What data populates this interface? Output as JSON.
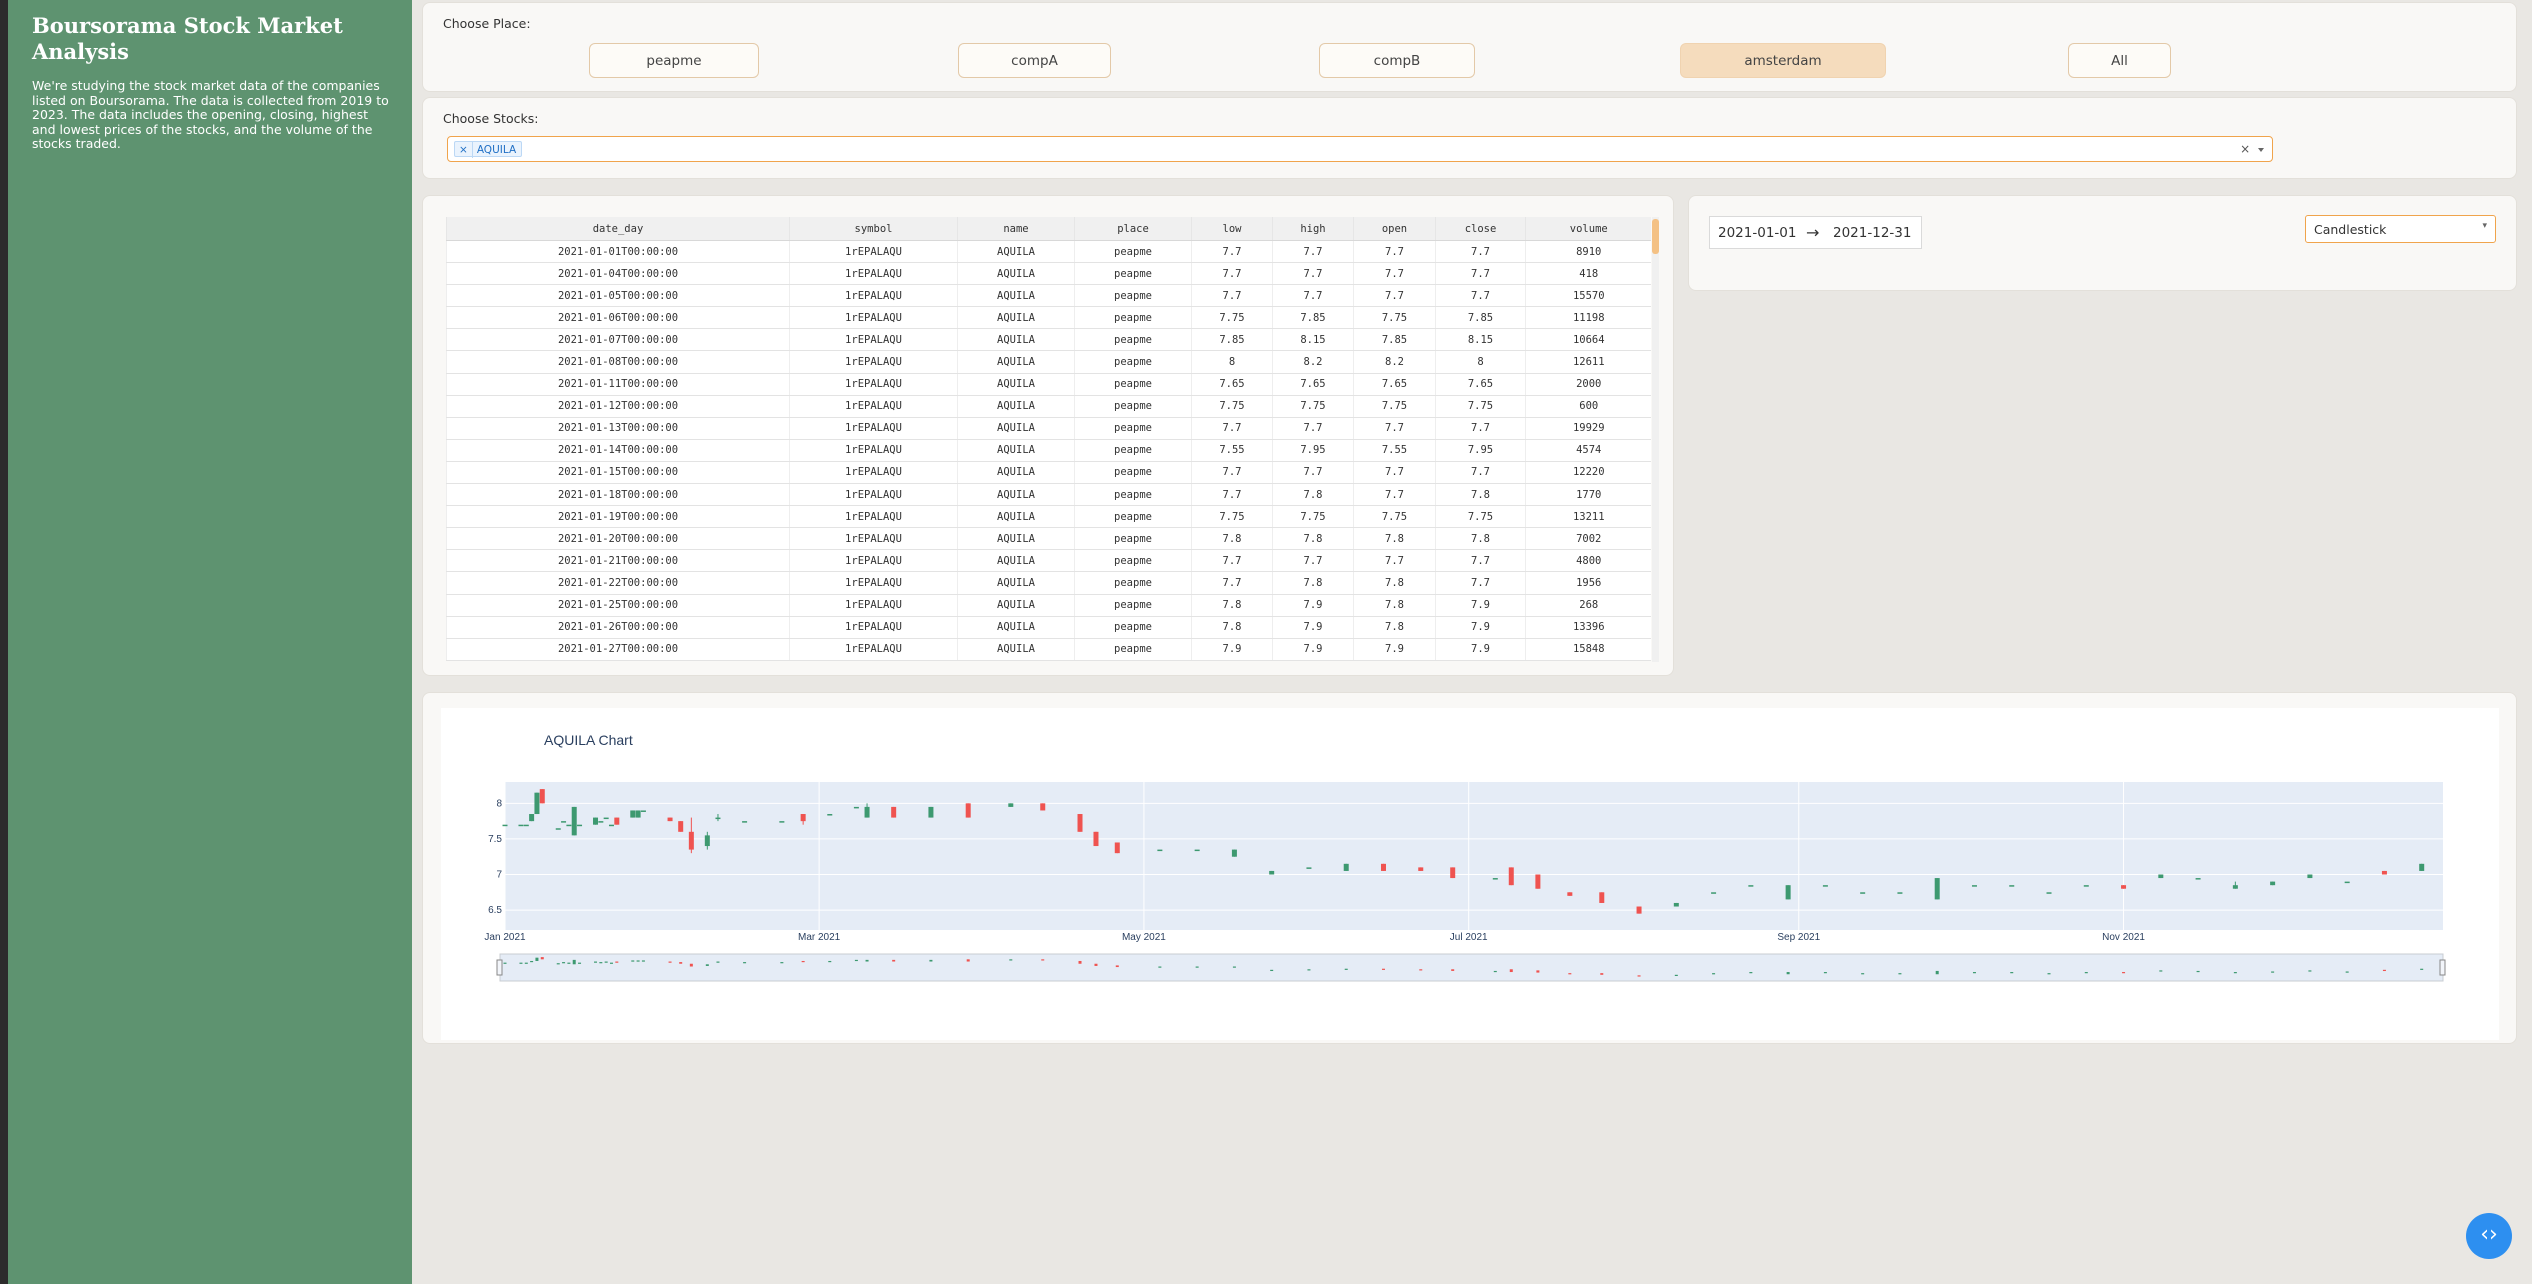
{
  "sidebar": {
    "title": "Boursorama Stock Market Analysis",
    "description": "We're studying the stock market data of the companies listed on Boursorama. The data is collected from 2019 to 2023. The data includes the opening, closing, highest and lowest prices of the stocks, and the volume of the stocks traded."
  },
  "place_selector": {
    "label": "Choose Place:",
    "options": [
      "peapme",
      "compA",
      "compB",
      "amsterdam",
      "All"
    ],
    "selected": "amsterdam"
  },
  "stock_selector": {
    "label": "Choose Stocks:",
    "selected_chip": "AQUILA",
    "remove_glyph": "×",
    "clear_glyph": "×"
  },
  "table": {
    "columns": [
      "date_day",
      "symbol",
      "name",
      "place",
      "low",
      "high",
      "open",
      "close",
      "volume"
    ],
    "rows": [
      [
        "2021-01-01T00:00:00",
        "1rEPALAQU",
        "AQUILA",
        "peapme",
        "7.7",
        "7.7",
        "7.7",
        "7.7",
        "8910"
      ],
      [
        "2021-01-04T00:00:00",
        "1rEPALAQU",
        "AQUILA",
        "peapme",
        "7.7",
        "7.7",
        "7.7",
        "7.7",
        "418"
      ],
      [
        "2021-01-05T00:00:00",
        "1rEPALAQU",
        "AQUILA",
        "peapme",
        "7.7",
        "7.7",
        "7.7",
        "7.7",
        "15570"
      ],
      [
        "2021-01-06T00:00:00",
        "1rEPALAQU",
        "AQUILA",
        "peapme",
        "7.75",
        "7.85",
        "7.75",
        "7.85",
        "11198"
      ],
      [
        "2021-01-07T00:00:00",
        "1rEPALAQU",
        "AQUILA",
        "peapme",
        "7.85",
        "8.15",
        "7.85",
        "8.15",
        "10664"
      ],
      [
        "2021-01-08T00:00:00",
        "1rEPALAQU",
        "AQUILA",
        "peapme",
        "8",
        "8.2",
        "8.2",
        "8",
        "12611"
      ],
      [
        "2021-01-11T00:00:00",
        "1rEPALAQU",
        "AQUILA",
        "peapme",
        "7.65",
        "7.65",
        "7.65",
        "7.65",
        "2000"
      ],
      [
        "2021-01-12T00:00:00",
        "1rEPALAQU",
        "AQUILA",
        "peapme",
        "7.75",
        "7.75",
        "7.75",
        "7.75",
        "600"
      ],
      [
        "2021-01-13T00:00:00",
        "1rEPALAQU",
        "AQUILA",
        "peapme",
        "7.7",
        "7.7",
        "7.7",
        "7.7",
        "19929"
      ],
      [
        "2021-01-14T00:00:00",
        "1rEPALAQU",
        "AQUILA",
        "peapme",
        "7.55",
        "7.95",
        "7.55",
        "7.95",
        "4574"
      ],
      [
        "2021-01-15T00:00:00",
        "1rEPALAQU",
        "AQUILA",
        "peapme",
        "7.7",
        "7.7",
        "7.7",
        "7.7",
        "12220"
      ],
      [
        "2021-01-18T00:00:00",
        "1rEPALAQU",
        "AQUILA",
        "peapme",
        "7.7",
        "7.8",
        "7.7",
        "7.8",
        "1770"
      ],
      [
        "2021-01-19T00:00:00",
        "1rEPALAQU",
        "AQUILA",
        "peapme",
        "7.75",
        "7.75",
        "7.75",
        "7.75",
        "13211"
      ],
      [
        "2021-01-20T00:00:00",
        "1rEPALAQU",
        "AQUILA",
        "peapme",
        "7.8",
        "7.8",
        "7.8",
        "7.8",
        "7002"
      ],
      [
        "2021-01-21T00:00:00",
        "1rEPALAQU",
        "AQUILA",
        "peapme",
        "7.7",
        "7.7",
        "7.7",
        "7.7",
        "4800"
      ],
      [
        "2021-01-22T00:00:00",
        "1rEPALAQU",
        "AQUILA",
        "peapme",
        "7.7",
        "7.8",
        "7.8",
        "7.7",
        "1956"
      ],
      [
        "2021-01-25T00:00:00",
        "1rEPALAQU",
        "AQUILA",
        "peapme",
        "7.8",
        "7.9",
        "7.8",
        "7.9",
        "268"
      ],
      [
        "2021-01-26T00:00:00",
        "1rEPALAQU",
        "AQUILA",
        "peapme",
        "7.8",
        "7.9",
        "7.8",
        "7.9",
        "13396"
      ],
      [
        "2021-01-27T00:00:00",
        "1rEPALAQU",
        "AQUILA",
        "peapme",
        "7.9",
        "7.9",
        "7.9",
        "7.9",
        "15848"
      ]
    ]
  },
  "date_range": {
    "start": "2021-01-01",
    "arrow": "→",
    "end": "2021-12-31"
  },
  "chart_type_select": {
    "value": "Candlestick",
    "caret": "▾"
  },
  "chart_data": {
    "type": "candlestick",
    "title": "AQUILA Chart",
    "xlabel": "",
    "ylabel": "",
    "x_ticks": [
      "Jan 2021",
      "Mar 2021",
      "May 2021",
      "Jul 2021",
      "Sep 2021",
      "Nov 2021"
    ],
    "y_ticks": [
      6.5,
      7,
      7.5,
      8
    ],
    "ylim": [
      6.22,
      8.3
    ],
    "x_range": [
      "2021-01-01",
      "2021-12-31"
    ],
    "increasing_color": "#3d9970",
    "decreasing_color": "#ef5350",
    "grid": true,
    "range_slider": true,
    "candles": [
      [
        "2021-01-01",
        7.7,
        7.7,
        7.7,
        7.7
      ],
      [
        "2021-01-04",
        7.7,
        7.7,
        7.7,
        7.7
      ],
      [
        "2021-01-05",
        7.7,
        7.7,
        7.7,
        7.7
      ],
      [
        "2021-01-06",
        7.75,
        7.85,
        7.75,
        7.85
      ],
      [
        "2021-01-07",
        7.85,
        8.15,
        7.85,
        8.15
      ],
      [
        "2021-01-08",
        8.2,
        8.2,
        8,
        8
      ],
      [
        "2021-01-11",
        7.65,
        7.65,
        7.65,
        7.65
      ],
      [
        "2021-01-12",
        7.75,
        7.75,
        7.75,
        7.75
      ],
      [
        "2021-01-13",
        7.7,
        7.7,
        7.7,
        7.7
      ],
      [
        "2021-01-14",
        7.55,
        7.95,
        7.55,
        7.95
      ],
      [
        "2021-01-15",
        7.7,
        7.7,
        7.7,
        7.7
      ],
      [
        "2021-01-18",
        7.7,
        7.8,
        7.7,
        7.8
      ],
      [
        "2021-01-19",
        7.75,
        7.75,
        7.75,
        7.75
      ],
      [
        "2021-01-20",
        7.8,
        7.8,
        7.8,
        7.8
      ],
      [
        "2021-01-21",
        7.7,
        7.7,
        7.7,
        7.7
      ],
      [
        "2021-01-22",
        7.8,
        7.8,
        7.7,
        7.7
      ],
      [
        "2021-01-25",
        7.8,
        7.9,
        7.8,
        7.9
      ],
      [
        "2021-01-26",
        7.8,
        7.9,
        7.8,
        7.9
      ],
      [
        "2021-01-27",
        7.9,
        7.9,
        7.9,
        7.9
      ],
      [
        "2021-02-01",
        7.8,
        7.8,
        7.75,
        7.75
      ],
      [
        "2021-02-03",
        7.75,
        7.75,
        7.6,
        7.6
      ],
      [
        "2021-02-05",
        7.6,
        7.8,
        7.3,
        7.35
      ],
      [
        "2021-02-08",
        7.4,
        7.6,
        7.35,
        7.55
      ],
      [
        "2021-02-10",
        7.8,
        7.85,
        7.75,
        7.8
      ],
      [
        "2021-02-15",
        7.75,
        7.75,
        7.75,
        7.75
      ],
      [
        "2021-02-22",
        7.75,
        7.75,
        7.75,
        7.75
      ],
      [
        "2021-02-26",
        7.85,
        7.85,
        7.7,
        7.75
      ],
      [
        "2021-03-03",
        7.85,
        7.85,
        7.85,
        7.85
      ],
      [
        "2021-03-08",
        7.95,
        7.95,
        7.95,
        7.95
      ],
      [
        "2021-03-10",
        7.8,
        8.0,
        7.8,
        7.95
      ],
      [
        "2021-03-15",
        7.95,
        7.95,
        7.8,
        7.8
      ],
      [
        "2021-03-22",
        7.8,
        7.95,
        7.8,
        7.95
      ],
      [
        "2021-03-29",
        8.0,
        8.0,
        7.8,
        7.8
      ],
      [
        "2021-04-06",
        7.95,
        8.0,
        7.95,
        8.0
      ],
      [
        "2021-04-12",
        8.0,
        8.0,
        7.9,
        7.9
      ],
      [
        "2021-04-19",
        7.85,
        7.85,
        7.6,
        7.6
      ],
      [
        "2021-04-22",
        7.6,
        7.6,
        7.4,
        7.4
      ],
      [
        "2021-04-26",
        7.45,
        7.45,
        7.3,
        7.3
      ],
      [
        "2021-05-04",
        7.35,
        7.35,
        7.35,
        7.35
      ],
      [
        "2021-05-11",
        7.35,
        7.35,
        7.35,
        7.35
      ],
      [
        "2021-05-18",
        7.25,
        7.35,
        7.25,
        7.35
      ],
      [
        "2021-05-25",
        7.0,
        7.05,
        7.0,
        7.05
      ],
      [
        "2021-06-01",
        7.1,
        7.1,
        7.1,
        7.1
      ],
      [
        "2021-06-08",
        7.05,
        7.15,
        7.05,
        7.15
      ],
      [
        "2021-06-15",
        7.15,
        7.15,
        7.05,
        7.05
      ],
      [
        "2021-06-22",
        7.1,
        7.1,
        7.05,
        7.05
      ],
      [
        "2021-06-28",
        7.1,
        7.1,
        6.95,
        6.95
      ],
      [
        "2021-07-06",
        6.95,
        6.95,
        6.95,
        6.95
      ],
      [
        "2021-07-09",
        7.1,
        7.1,
        6.85,
        6.85
      ],
      [
        "2021-07-14",
        7.0,
        7.0,
        6.8,
        6.8
      ],
      [
        "2021-07-20",
        6.75,
        6.75,
        6.7,
        6.7
      ],
      [
        "2021-07-26",
        6.75,
        6.75,
        6.6,
        6.6
      ],
      [
        "2021-08-02",
        6.55,
        6.55,
        6.45,
        6.45
      ],
      [
        "2021-08-09",
        6.55,
        6.6,
        6.55,
        6.6
      ],
      [
        "2021-08-16",
        6.75,
        6.75,
        6.75,
        6.75
      ],
      [
        "2021-08-23",
        6.85,
        6.85,
        6.85,
        6.85
      ],
      [
        "2021-08-30",
        6.65,
        6.85,
        6.65,
        6.85
      ],
      [
        "2021-09-06",
        6.85,
        6.85,
        6.85,
        6.85
      ],
      [
        "2021-09-13",
        6.75,
        6.75,
        6.75,
        6.75
      ],
      [
        "2021-09-20",
        6.75,
        6.75,
        6.75,
        6.75
      ],
      [
        "2021-09-27",
        6.65,
        6.95,
        6.65,
        6.95
      ],
      [
        "2021-10-04",
        6.85,
        6.85,
        6.85,
        6.85
      ],
      [
        "2021-10-11",
        6.85,
        6.85,
        6.85,
        6.85
      ],
      [
        "2021-10-18",
        6.75,
        6.75,
        6.75,
        6.75
      ],
      [
        "2021-10-25",
        6.85,
        6.85,
        6.85,
        6.85
      ],
      [
        "2021-11-01",
        6.85,
        6.85,
        6.8,
        6.8
      ],
      [
        "2021-11-08",
        6.95,
        7.0,
        6.95,
        7.0
      ],
      [
        "2021-11-15",
        6.95,
        6.95,
        6.95,
        6.95
      ],
      [
        "2021-11-22",
        6.8,
        6.9,
        6.8,
        6.85
      ],
      [
        "2021-11-29",
        6.85,
        6.9,
        6.85,
        6.9
      ],
      [
        "2021-12-06",
        6.95,
        7.0,
        6.95,
        7.0
      ],
      [
        "2021-12-13",
        6.9,
        6.9,
        6.9,
        6.9
      ],
      [
        "2021-12-20",
        7.05,
        7.05,
        7.0,
        7.0
      ],
      [
        "2021-12-27",
        7.05,
        7.15,
        7.05,
        7.15
      ]
    ]
  },
  "code_button": {
    "glyph": "‹›"
  }
}
